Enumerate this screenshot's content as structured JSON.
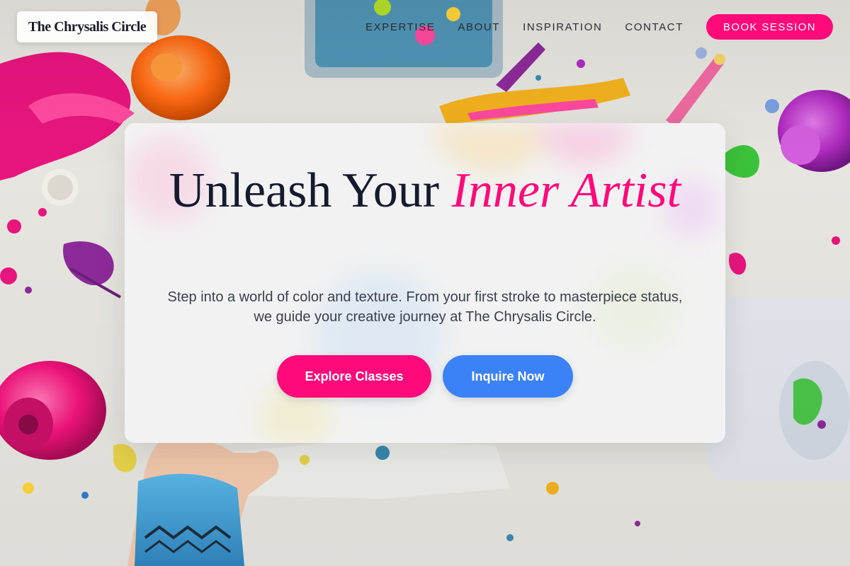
{
  "brand": {
    "name": "The Chrysalis Circle"
  },
  "nav": {
    "items": [
      {
        "label": "EXPERTISE"
      },
      {
        "label": "ABOUT"
      },
      {
        "label": "INSPIRATION"
      },
      {
        "label": "CONTACT"
      }
    ],
    "cta_label": "BOOK SESSION"
  },
  "hero": {
    "title_plain": "Unleash Your ",
    "title_accent": "Inner Artist",
    "subtitle": "Step into a world of color and texture. From your first stroke to masterpiece status, we guide your creative journey at The Chrysalis Circle.",
    "primary_label": "Explore Classes",
    "secondary_label": "Inquire Now"
  },
  "colors": {
    "accent_pink": "#ff0a7a",
    "accent_blue": "#3b82f6",
    "heading_dark": "#161a2e"
  }
}
